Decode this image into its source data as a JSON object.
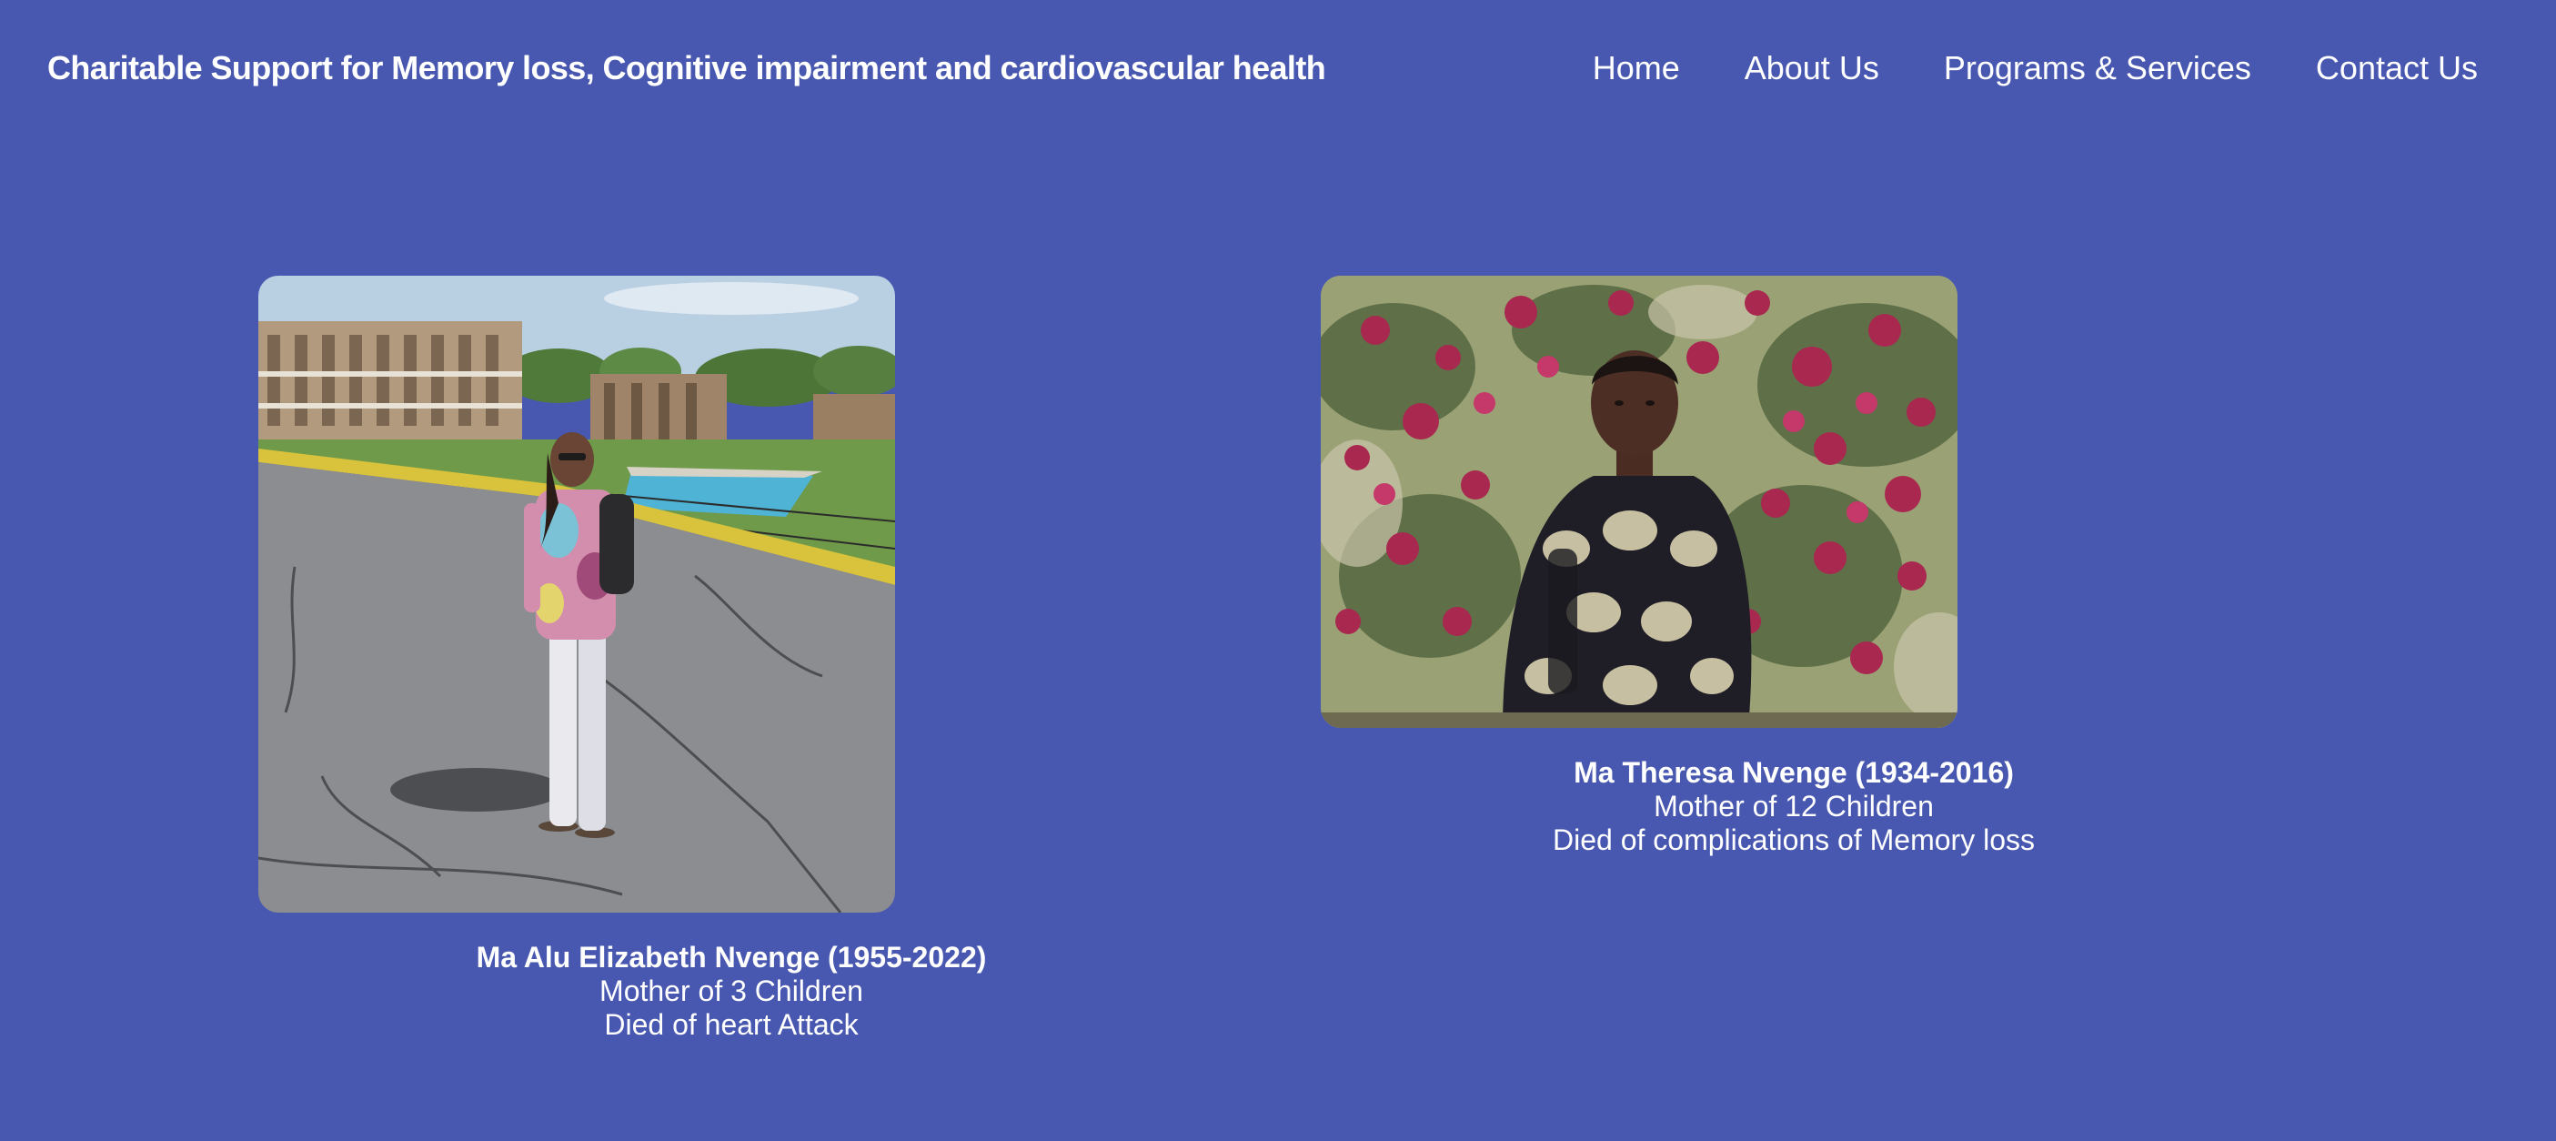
{
  "header": {
    "site_title": "Charitable Support for Memory loss, Cognitive impairment and cardiovascular health",
    "nav": [
      {
        "label": "Home"
      },
      {
        "label": "About Us"
      },
      {
        "label": "Programs & Services"
      },
      {
        "label": "Contact Us"
      }
    ]
  },
  "memorials": [
    {
      "name": "Ma Alu Elizabeth Nvenge (1955-2022)",
      "line1": "Mother of 3 Children",
      "line2": "Died of heart Attack"
    },
    {
      "name": "Ma Theresa Nvenge (1934-2016)",
      "line1": "Mother of 12 Children",
      "line2": "Died of complications of Memory loss"
    }
  ],
  "colors": {
    "background": "#4858b0",
    "text": "#ffffff"
  }
}
